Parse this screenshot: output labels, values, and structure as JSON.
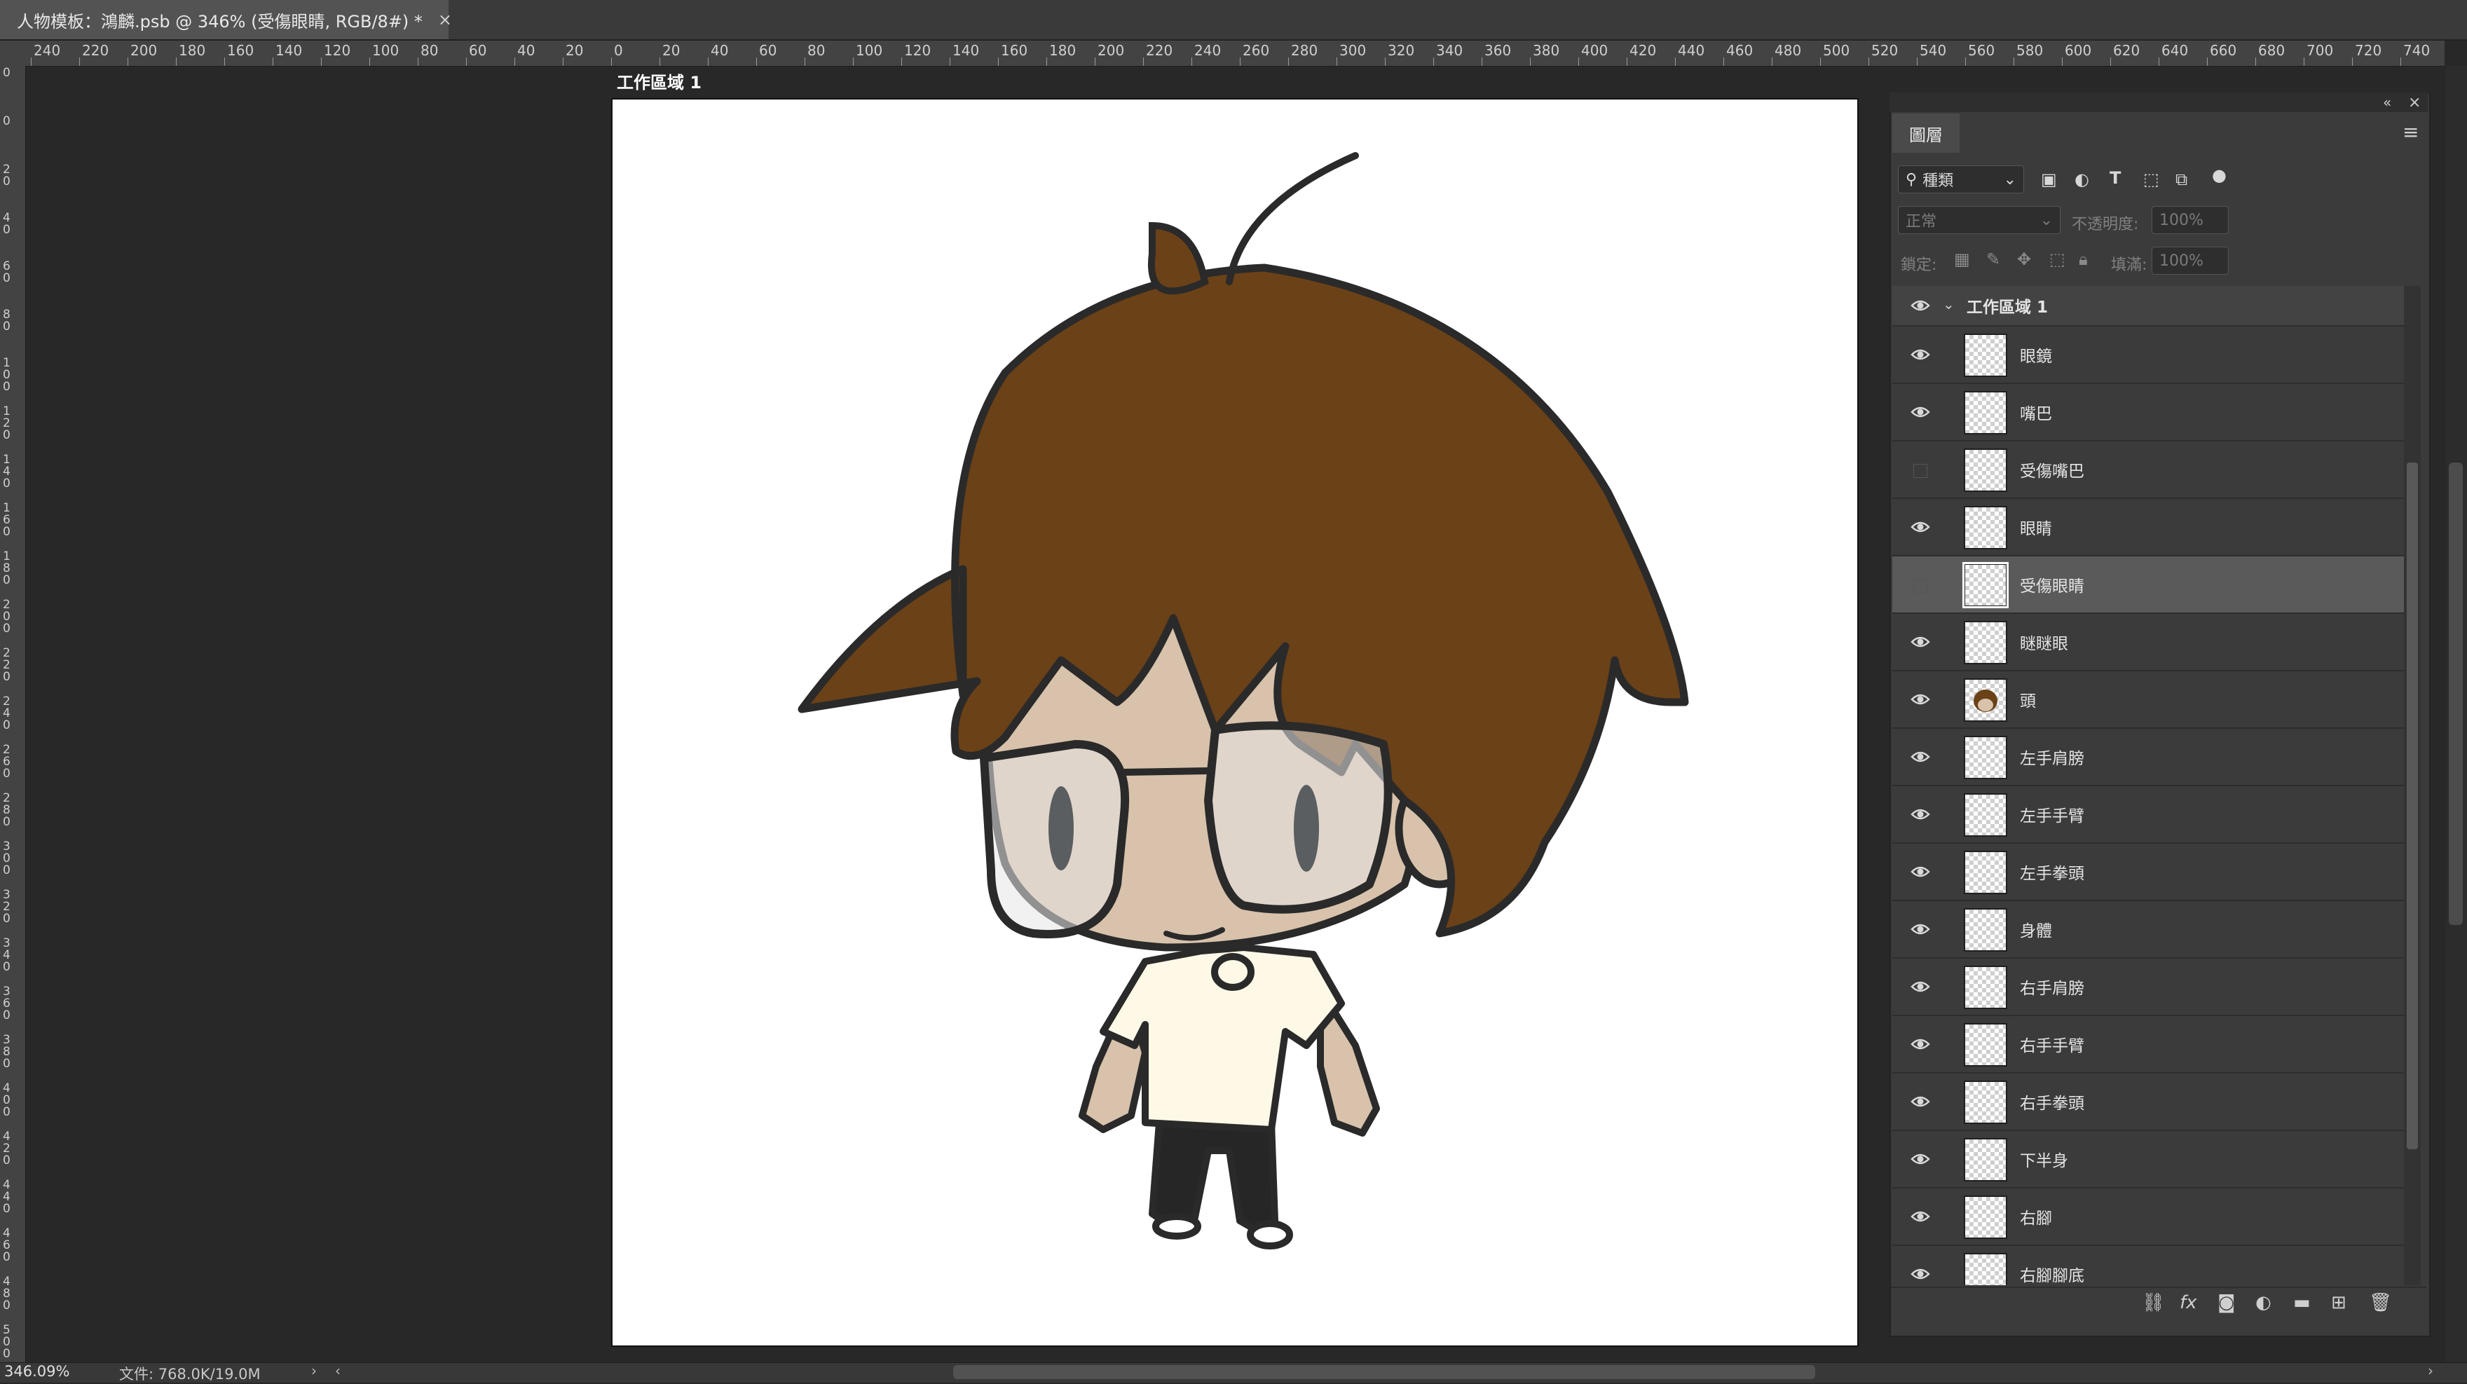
{
  "document_tab": {
    "title": "人物模板：鴻麟.psb @ 346% (受傷眼睛, RGB/8#) *",
    "close_glyph": "×"
  },
  "rulers": {
    "horizontal_labels": [
      "240",
      "220",
      "200",
      "180",
      "160",
      "140",
      "120",
      "100",
      "80",
      "60",
      "40",
      "20",
      "0",
      "20",
      "40",
      "60",
      "80",
      "100",
      "120",
      "140",
      "160",
      "180",
      "200",
      "220",
      "240",
      "260",
      "280",
      "300",
      "320",
      "340",
      "360",
      "380",
      "400",
      "420",
      "440",
      "460",
      "480",
      "500",
      "520",
      "540",
      "560",
      "580",
      "600",
      "620",
      "640",
      "660",
      "680",
      "700",
      "720",
      "740"
    ],
    "vertical_labels": [
      "0",
      "0",
      "20",
      "40",
      "60",
      "80",
      "100",
      "120",
      "140",
      "160",
      "180",
      "200",
      "220",
      "240",
      "260",
      "280",
      "300",
      "320",
      "340",
      "360",
      "380",
      "400",
      "420",
      "440",
      "460",
      "480",
      "500"
    ]
  },
  "artboard": {
    "label": "工作區域 1"
  },
  "layers_panel": {
    "tab_label": "圖層",
    "menu_glyph": "≡",
    "collapse_glyph": "«",
    "close_glyph": "×",
    "filter": {
      "kind_label": "種類"
    },
    "blend_mode": "正常",
    "opacity_label": "不透明度:",
    "opacity_value": "100%",
    "lock_label": "鎖定:",
    "fill_label": "填滿:",
    "fill_value": "100%",
    "group": {
      "name": "工作區域 1",
      "visible": true
    },
    "layers": [
      {
        "name": "眼鏡",
        "visible": true,
        "selected": false
      },
      {
        "name": "嘴巴",
        "visible": true,
        "selected": false
      },
      {
        "name": "受傷嘴巴",
        "visible": false,
        "selected": false
      },
      {
        "name": "眼睛",
        "visible": true,
        "selected": false
      },
      {
        "name": "受傷眼睛",
        "visible": false,
        "selected": true
      },
      {
        "name": "瞇瞇眼",
        "visible": true,
        "selected": false
      },
      {
        "name": "頭",
        "visible": true,
        "selected": false
      },
      {
        "name": "左手肩膀",
        "visible": true,
        "selected": false
      },
      {
        "name": "左手手臂",
        "visible": true,
        "selected": false
      },
      {
        "name": "左手拳頭",
        "visible": true,
        "selected": false
      },
      {
        "name": "身體",
        "visible": true,
        "selected": false
      },
      {
        "name": "右手肩膀",
        "visible": true,
        "selected": false
      },
      {
        "name": "右手手臂",
        "visible": true,
        "selected": false
      },
      {
        "name": "右手拳頭",
        "visible": true,
        "selected": false
      },
      {
        "name": "下半身",
        "visible": true,
        "selected": false
      },
      {
        "name": "右腳",
        "visible": true,
        "selected": false
      },
      {
        "name": "右腳腳底",
        "visible": true,
        "selected": false
      }
    ]
  },
  "status": {
    "zoom": "346.09%",
    "file_info": "文件: 768.0K/19.0M"
  },
  "colors": {
    "hair": "#6b4118",
    "skin": "#d8c2ab",
    "shirt": "#fdf9e6",
    "pants": "#222222",
    "accent_selected": "#5a5a5a"
  }
}
